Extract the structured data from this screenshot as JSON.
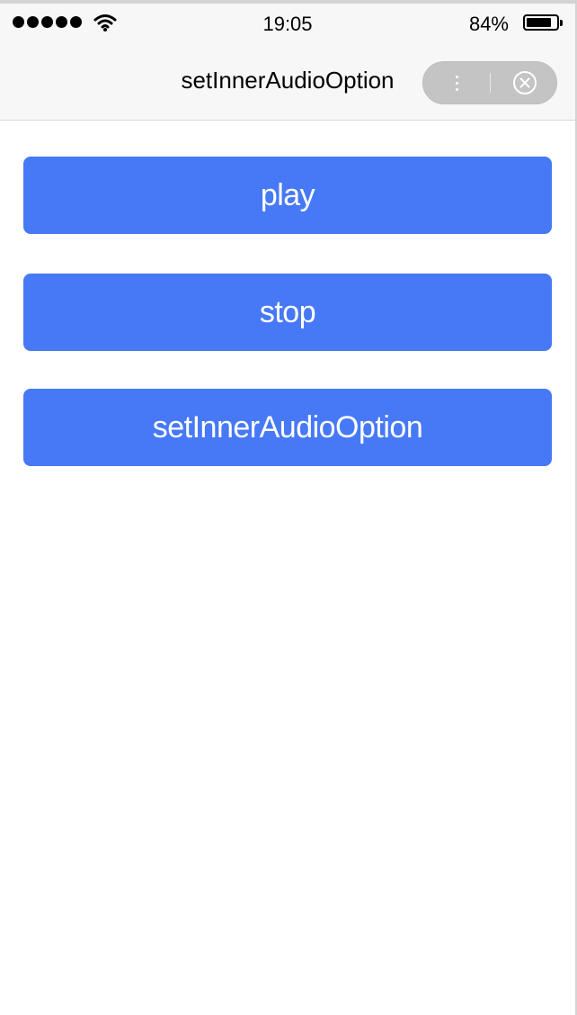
{
  "status_bar": {
    "time": "19:05",
    "battery_percent": "84%",
    "signal_icon": "signal-dots-icon",
    "wifi_icon": "wifi-icon",
    "battery_icon": "battery-icon",
    "battery_level": 0.84
  },
  "nav_bar": {
    "title": "setInnerAudioOption",
    "more_icon": "more-dots-icon",
    "close_icon": "close-circle-icon"
  },
  "buttons": {
    "play_label": "play",
    "stop_label": "stop",
    "set_option_label": "setInnerAudioOption"
  },
  "colors": {
    "button_bg": "#4779f6",
    "button_text": "#ffffff",
    "nav_bg": "#f7f7f7",
    "capsule_bg": "#c4c4c4"
  }
}
